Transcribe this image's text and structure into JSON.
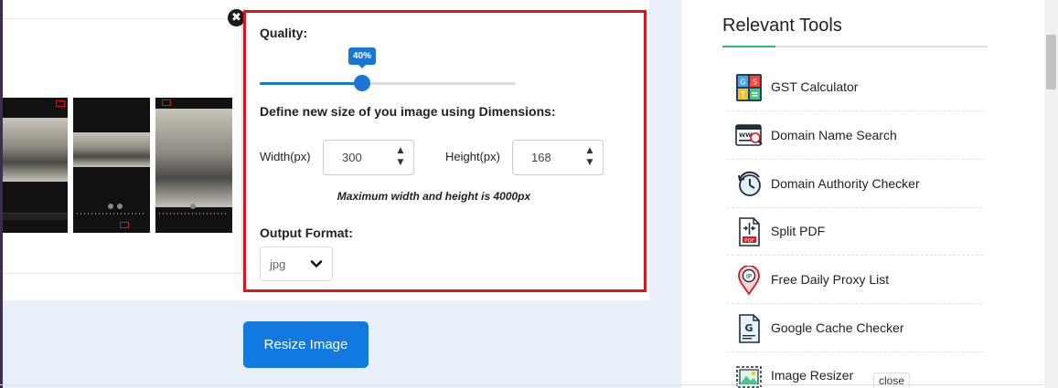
{
  "settings": {
    "quality_label": "Quality:",
    "quality_value": 40,
    "quality_tooltip": "40%",
    "dimensions_label": "Define new size of you image using Dimensions:",
    "width_label": "Width(px)",
    "width_value": "300",
    "height_label": "Height(px)",
    "height_value": "168",
    "max_note": "Maximum width and height is 4000px",
    "format_label": "Output Format:",
    "format_value": "jpg"
  },
  "actions": {
    "close_symbol": "✖",
    "resize_button": "Resize Image"
  },
  "sidebar": {
    "title": "Relevant Tools",
    "tools": [
      {
        "name": "GST Calculator",
        "icon": "gst-calculator-icon"
      },
      {
        "name": "Domain Name Search",
        "icon": "domain-search-icon"
      },
      {
        "name": "Domain Authority Checker",
        "icon": "domain-authority-icon"
      },
      {
        "name": "Split PDF",
        "icon": "split-pdf-icon"
      },
      {
        "name": "Free Daily Proxy List",
        "icon": "proxy-location-icon"
      },
      {
        "name": "Google Cache Checker",
        "icon": "google-cache-icon"
      },
      {
        "name": "Image Resizer",
        "icon": "image-resizer-icon"
      }
    ],
    "close_chip": "close"
  },
  "colors": {
    "accent_blue": "#1279e0",
    "slider_blue": "#1976d2",
    "highlight_red": "#e0141b",
    "title_underline_green": "#21c46a"
  }
}
